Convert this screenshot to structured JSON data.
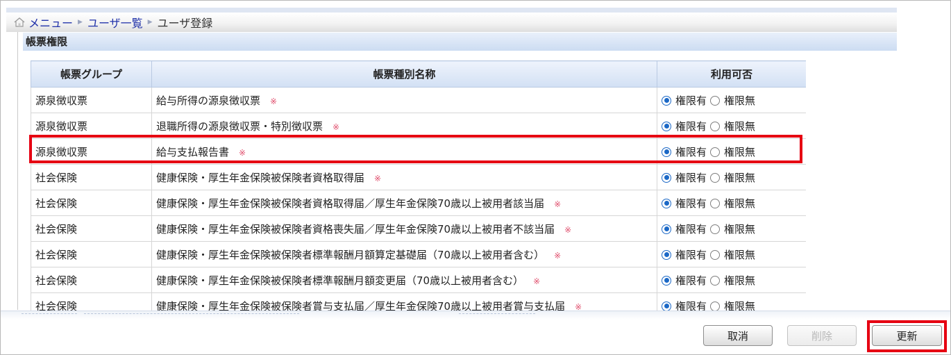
{
  "breadcrumb": {
    "items": [
      "メニュー",
      "ユーザ一覧"
    ],
    "current": "ユーザ登録"
  },
  "section": {
    "title": "帳票権限"
  },
  "table": {
    "headers": [
      "帳票グループ",
      "帳票種別名称",
      "利用可否"
    ],
    "option_yes": "権限有",
    "option_no": "権限無",
    "required_mark": "※",
    "rows": [
      {
        "group": "源泉徴収票",
        "name": "給与所得の源泉徴収票",
        "allowed": true
      },
      {
        "group": "源泉徴収票",
        "name": "退職所得の源泉徴収票・特別徴収票",
        "allowed": true
      },
      {
        "group": "源泉徴収票",
        "name": "給与支払報告書",
        "allowed": true
      },
      {
        "group": "社会保険",
        "name": "健康保険・厚生年金保険被保険者資格取得届",
        "allowed": true
      },
      {
        "group": "社会保険",
        "name": "健康保険・厚生年金保険被保険者資格取得届／厚生年金保険70歳以上被用者該当届",
        "allowed": true
      },
      {
        "group": "社会保険",
        "name": "健康保険・厚生年金保険被保険者資格喪失届／厚生年金保険70歳以上被用者不該当届",
        "allowed": true
      },
      {
        "group": "社会保険",
        "name": "健康保険・厚生年金保険被保険者標準報酬月額算定基礎届（70歳以上被用者含む）",
        "allowed": true
      },
      {
        "group": "社会保険",
        "name": "健康保険・厚生年金保険被保険者標準報酬月額変更届（70歳以上被用者含む）",
        "allowed": true
      },
      {
        "group": "社会保険",
        "name": "健康保険・厚生年金保険被保険者賞与支払届／厚生年金保険70歳以上被用者賞与支払届",
        "allowed": true
      }
    ]
  },
  "buttons": {
    "cancel": "取消",
    "delete": "削除",
    "update": "更新"
  },
  "colors": {
    "highlight": "#e60012",
    "link": "#2233aa",
    "radio_selected": "#1b68c6"
  }
}
